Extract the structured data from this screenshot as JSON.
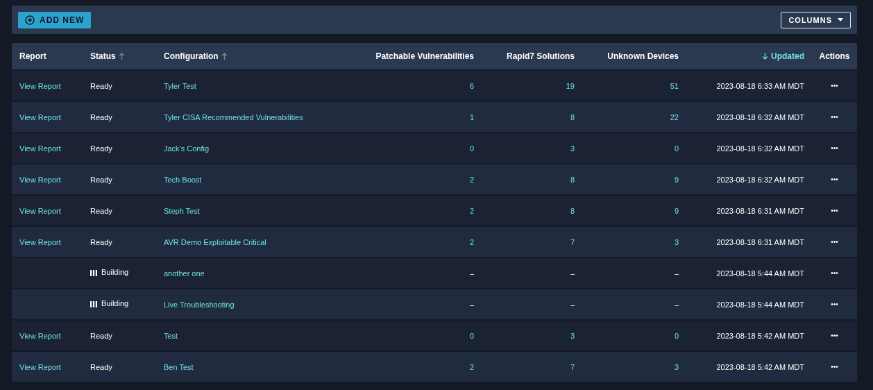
{
  "toolbar": {
    "add_button": "ADD NEW",
    "columns_button": "COLUMNS"
  },
  "table": {
    "columns": [
      {
        "label": "Report"
      },
      {
        "label": "Status",
        "sortable": true,
        "descending": false,
        "selected": false
      },
      {
        "label": "Configuration",
        "sortable": true,
        "descending": false,
        "selected": false
      },
      {
        "label": "Patchable Vulnerabilities"
      },
      {
        "label": "Rapid7 Solutions"
      },
      {
        "label": "Unknown Devices"
      },
      {
        "label": "Updated",
        "sortable": true,
        "descending": true,
        "selected": true
      },
      {
        "label": "Actions"
      }
    ],
    "rows": [
      {
        "kind": "ready",
        "report": "View Report",
        "status": "Ready",
        "configuration": "Tyler Test",
        "patchable": "6",
        "solutions": "19",
        "devices": "51",
        "updated": "2023-08-18 6:33 AM MDT",
        "actions": "•••"
      },
      {
        "kind": "ready",
        "report": "View Report",
        "status": "Ready",
        "configuration": "Tyler CISA Recommended Vulnerabilities",
        "patchable": "1",
        "solutions": "8",
        "devices": "22",
        "updated": "2023-08-18 6:32 AM MDT",
        "actions": "•••"
      },
      {
        "kind": "ready",
        "report": "View Report",
        "status": "Ready",
        "configuration": "Jack's Config",
        "patchable": "0",
        "solutions": "3",
        "devices": "0",
        "updated": "2023-08-18 6:32 AM MDT",
        "actions": "•••"
      },
      {
        "kind": "ready",
        "report": "View Report",
        "status": "Ready",
        "configuration": "Tech Boost",
        "patchable": "2",
        "solutions": "8",
        "devices": "9",
        "updated": "2023-08-18 6:32 AM MDT",
        "actions": "•••"
      },
      {
        "kind": "ready",
        "report": "View Report",
        "status": "Ready",
        "configuration": "Steph Test",
        "patchable": "2",
        "solutions": "8",
        "devices": "9",
        "updated": "2023-08-18 6:31 AM MDT",
        "actions": "•••"
      },
      {
        "kind": "ready",
        "report": "View Report",
        "status": "Ready",
        "configuration": "AVR Demo Exploitable Critical",
        "patchable": "2",
        "solutions": "7",
        "devices": "3",
        "updated": "2023-08-18 6:31 AM MDT",
        "actions": "•••"
      },
      {
        "kind": "building",
        "status": "Building",
        "configuration": "another one",
        "patchable": "–",
        "solutions": "–",
        "devices": "–",
        "updated": "2023-08-18 5:44 AM MDT",
        "actions": "•••"
      },
      {
        "kind": "building",
        "status": "Building",
        "configuration": "Live Troubleshooting",
        "patchable": "–",
        "solutions": "–",
        "devices": "–",
        "updated": "2023-08-18 5:44 AM MDT",
        "actions": "•••"
      },
      {
        "kind": "ready",
        "report": "View Report",
        "status": "Ready",
        "configuration": "Test",
        "patchable": "0",
        "solutions": "3",
        "devices": "0",
        "updated": "2023-08-18 5:42 AM MDT",
        "actions": "•••"
      },
      {
        "kind": "ready",
        "report": "View Report",
        "status": "Ready",
        "configuration": "Ben Test",
        "patchable": "2",
        "solutions": "7",
        "devices": "3",
        "updated": "2023-08-18 5:42 AM MDT",
        "actions": "•••"
      }
    ]
  }
}
